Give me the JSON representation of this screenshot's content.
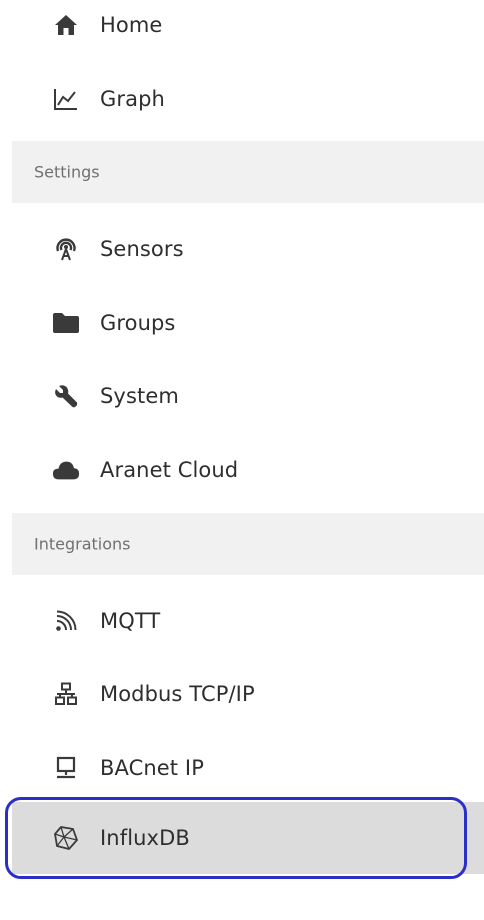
{
  "menu": {
    "top_items": [
      {
        "label": "Home",
        "icon": "home-icon"
      },
      {
        "label": "Graph",
        "icon": "graph-icon"
      }
    ],
    "settings": {
      "title": "Settings",
      "items": [
        {
          "label": "Sensors",
          "icon": "sensor-signal-icon"
        },
        {
          "label": "Groups",
          "icon": "folder-icon"
        },
        {
          "label": "System",
          "icon": "wrench-icon"
        },
        {
          "label": "Aranet Cloud",
          "icon": "cloud-icon"
        }
      ]
    },
    "integrations": {
      "title": "Integrations",
      "items": [
        {
          "label": "MQTT",
          "icon": "rss-feed-icon"
        },
        {
          "label": "Modbus TCP/IP",
          "icon": "network-icon"
        },
        {
          "label": "BACnet IP",
          "icon": "desktop-monitor-icon"
        },
        {
          "label": "InfluxDB",
          "icon": "influxdb-icon",
          "selected": true
        }
      ]
    }
  },
  "colors": {
    "text": "#2e2e2e",
    "icon": "#3a3a3a",
    "section_bg": "#f1f1f1",
    "section_text": "#707070",
    "active_bg": "#dcdcdc",
    "highlight": "#2c2fc7"
  }
}
